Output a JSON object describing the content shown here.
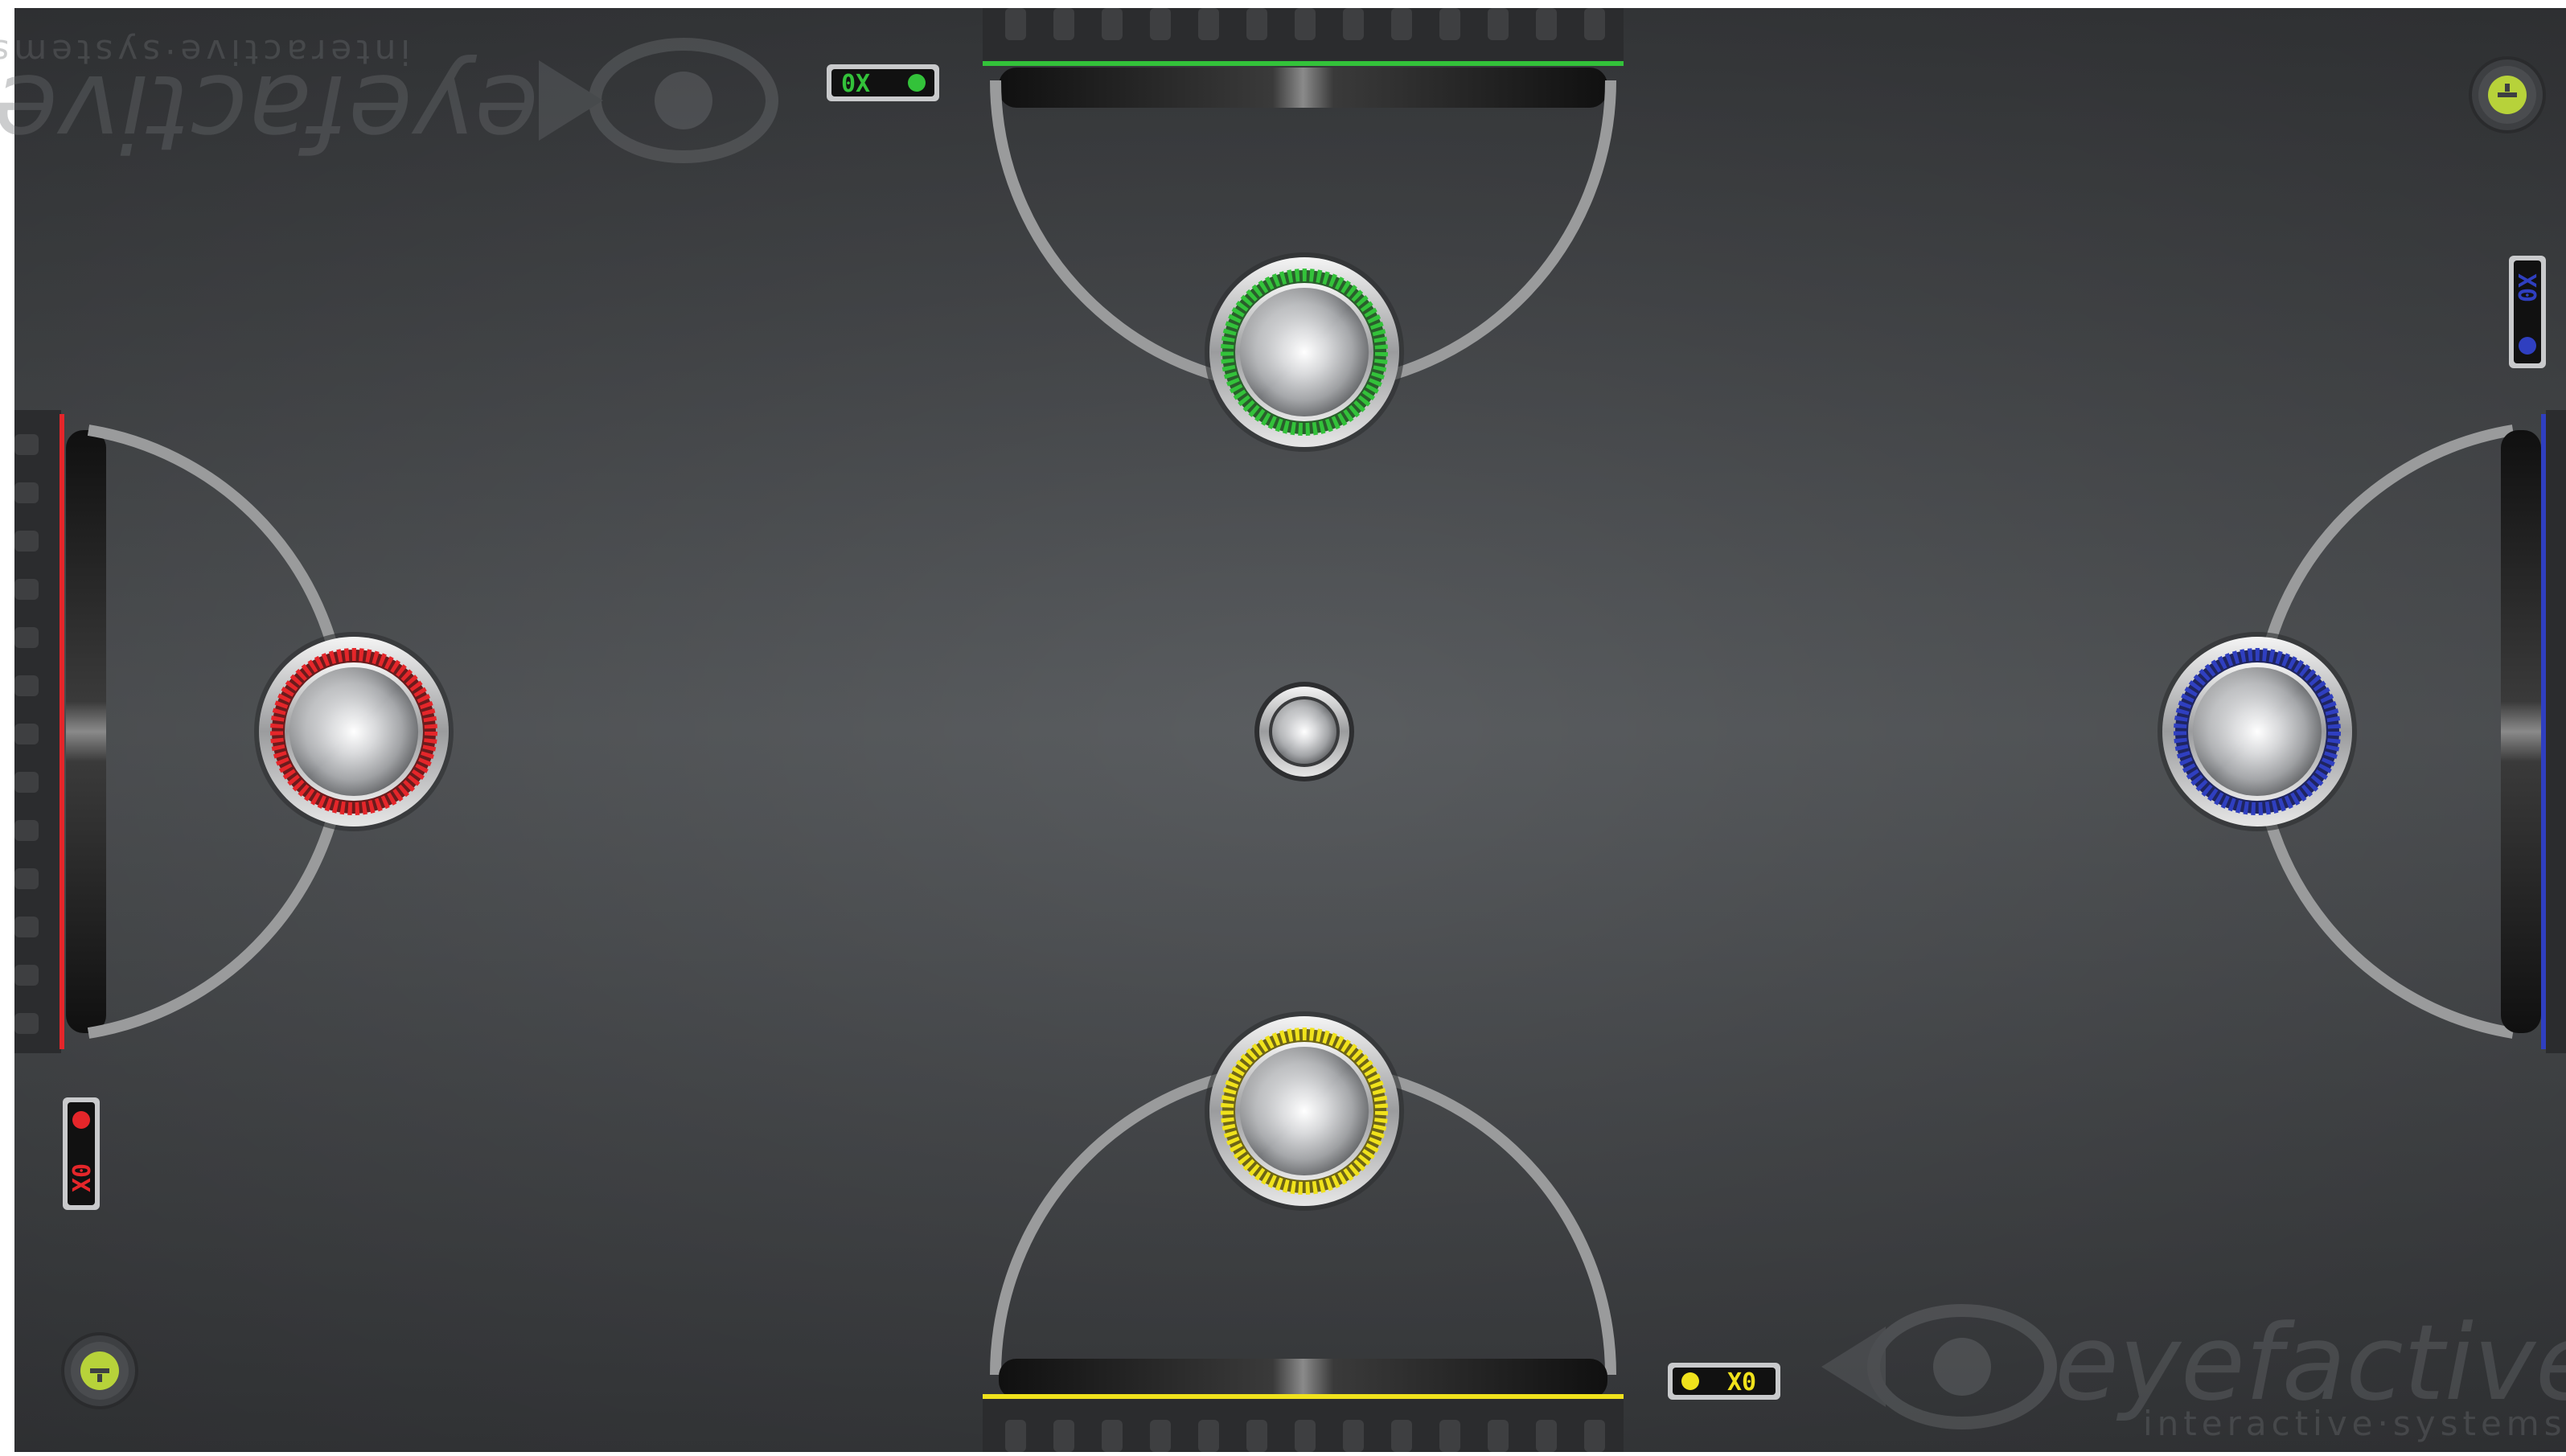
{
  "game": {
    "players": [
      {
        "id": "green",
        "color": "#33c23a",
        "score_label": "0X",
        "score": 0,
        "side": "top"
      },
      {
        "id": "yellow",
        "color": "#f0e21c",
        "score_label": "X0",
        "score": 0,
        "side": "bottom"
      },
      {
        "id": "red",
        "color": "#e5262a",
        "score_label": "X0",
        "score": 0,
        "side": "left"
      },
      {
        "id": "blue",
        "color": "#2f3fc0",
        "score_label": "X0",
        "score": 0,
        "side": "right"
      }
    ]
  },
  "brand": {
    "name": "eyefactive",
    "tagline": "interactive·systems"
  },
  "colors": {
    "background": "#55585b",
    "line": "#9a9b9c",
    "border": "#ffffff"
  }
}
